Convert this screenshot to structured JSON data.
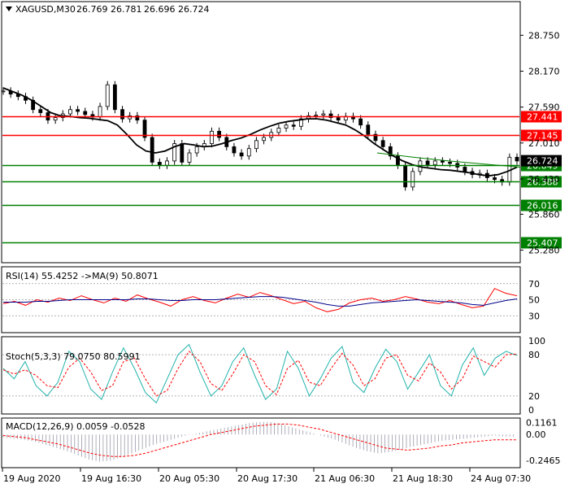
{
  "chart_data": {
    "type": "candlestick",
    "symbol_title": "XAGUSD,M30",
    "ohlc_header": [
      "26.769",
      "26.781",
      "26.696",
      "26.724"
    ],
    "current_price_label": "26.724",
    "y_ticks": [
      "28.750",
      "28.170",
      "27.590",
      "27.010",
      "26.430",
      "25.860",
      "25.280"
    ],
    "y_tick_values": [
      28.75,
      28.17,
      27.59,
      27.01,
      26.43,
      25.86,
      25.28
    ],
    "y_range": [
      25.09,
      29.28
    ],
    "x_ticks": [
      "19 Aug 2020",
      "19 Aug 16:30",
      "20 Aug 05:30",
      "20 Aug 17:30",
      "21 Aug 06:30",
      "21 Aug 18:30",
      "24 Aug 07:30"
    ],
    "levels": [
      {
        "value": 27.441,
        "label": "27.441",
        "color": "#ff0000"
      },
      {
        "value": 27.145,
        "label": "27.145",
        "color": "#ff0000"
      },
      {
        "value": 26.649,
        "label": "26.649",
        "color": "#008000"
      },
      {
        "value": 26.388,
        "label": "26.388",
        "color": "#008000"
      },
      {
        "value": 26.016,
        "label": "26.016",
        "color": "#008000"
      },
      {
        "value": 25.407,
        "label": "25.407",
        "color": "#008000"
      }
    ],
    "price_series": [
      27.85,
      27.8,
      27.76,
      27.7,
      27.55,
      27.5,
      27.38,
      27.42,
      27.48,
      27.55,
      27.52,
      27.47,
      27.43,
      27.6,
      27.95,
      27.55,
      27.4,
      27.45,
      27.38,
      27.1,
      26.7,
      26.65,
      26.72,
      27.0,
      26.7,
      26.85,
      26.95,
      27.0,
      27.2,
      27.1,
      26.95,
      26.85,
      26.8,
      26.92,
      27.05,
      27.1,
      27.18,
      27.25,
      27.3,
      27.28,
      27.4,
      27.45,
      27.46,
      27.48,
      27.42,
      27.38,
      27.44,
      27.4,
      27.3,
      27.15,
      27.05,
      26.95,
      26.8,
      26.65,
      26.3,
      26.55,
      26.72,
      26.66,
      26.72,
      26.7,
      26.68,
      26.62,
      26.55,
      26.5,
      26.52,
      26.45,
      26.42,
      26.38,
      26.78,
      26.72
    ],
    "ma_series": [
      27.9,
      27.84,
      27.78,
      27.7,
      27.6,
      27.5,
      27.45,
      27.44,
      27.42,
      27.41,
      27.39,
      27.37,
      27.3,
      27.15,
      26.98,
      26.88,
      26.85,
      26.88,
      26.95,
      27.0,
      26.98,
      26.95,
      26.96,
      27.0,
      27.05,
      27.09,
      27.15,
      27.22,
      27.28,
      27.33,
      27.36,
      27.38,
      27.4,
      27.4,
      27.38,
      27.34,
      27.3,
      27.22,
      27.12,
      27.0,
      26.9,
      26.8,
      26.72,
      26.66,
      26.62,
      26.6,
      26.58,
      26.57,
      26.55,
      26.53,
      26.5,
      26.48,
      26.5,
      26.55,
      26.62
    ],
    "trend_series": [
      26.85,
      26.78,
      26.72,
      26.67,
      26.62
    ],
    "rsi": {
      "label": "RSI(14) 55.4252  ->MA(9) 50.8071",
      "ticks": [
        "70",
        "50",
        "30"
      ],
      "tick_values": [
        70,
        50,
        30
      ],
      "range": [
        10,
        90
      ],
      "values": [
        45,
        48,
        43,
        50,
        47,
        52,
        49,
        55,
        50,
        46,
        52,
        48,
        56,
        51,
        47,
        42,
        50,
        54,
        49,
        46,
        52,
        57,
        53,
        59,
        55,
        50,
        45,
        48,
        40,
        35,
        38,
        46,
        50,
        52,
        48,
        50,
        54,
        51,
        47,
        45,
        49,
        44,
        40,
        42,
        64,
        58,
        55
      ],
      "ma_values": [
        47,
        47,
        47,
        48,
        48,
        49,
        50,
        50,
        50,
        50,
        50,
        50,
        51,
        51,
        50,
        49,
        49,
        50,
        50,
        50,
        51,
        52,
        53,
        54,
        54,
        53,
        51,
        49,
        47,
        44,
        42,
        42,
        44,
        46,
        47,
        48,
        49,
        50,
        49,
        48,
        47,
        46,
        44,
        43,
        46,
        49,
        51
      ]
    },
    "stoch": {
      "label": "Stoch(5,3,3) 79.0750 80.5991",
      "ticks": [
        "100",
        "80",
        "20",
        "0"
      ],
      "tick_values": [
        100,
        80,
        20,
        0
      ],
      "range": [
        -5,
        105
      ],
      "main": [
        60,
        45,
        70,
        35,
        20,
        40,
        85,
        70,
        30,
        15,
        55,
        90,
        60,
        25,
        10,
        45,
        80,
        95,
        55,
        20,
        35,
        70,
        90,
        50,
        15,
        30,
        85,
        60,
        20,
        45,
        75,
        92,
        40,
        25,
        60,
        88,
        70,
        30,
        55,
        80,
        35,
        20,
        65,
        90,
        50,
        75,
        85,
        79
      ],
      "signal": [
        58,
        52,
        58,
        50,
        35,
        32,
        62,
        75,
        55,
        28,
        35,
        70,
        75,
        45,
        20,
        28,
        60,
        85,
        70,
        38,
        28,
        52,
        80,
        70,
        35,
        22,
        60,
        72,
        40,
        35,
        60,
        82,
        65,
        35,
        45,
        75,
        80,
        50,
        42,
        68,
        55,
        30,
        45,
        78,
        70,
        62,
        80,
        81
      ]
    },
    "macd": {
      "label": "MACD(12,26,9) 0.0059 -0.0528",
      "ticks": [
        "0.1161",
        "0.00",
        "-0.2465"
      ],
      "tick_values": [
        0.1161,
        0.0,
        -0.2465
      ],
      "range": [
        -0.31,
        0.15
      ],
      "histogram": [
        -0.03,
        -0.04,
        -0.05,
        -0.07,
        -0.1,
        -0.13,
        -0.16,
        -0.2,
        -0.24,
        -0.26,
        -0.25,
        -0.22,
        -0.18,
        -0.14,
        -0.1,
        -0.07,
        -0.04,
        -0.01,
        0.01,
        0.03,
        0.05,
        0.07,
        0.09,
        0.11,
        0.12,
        0.12,
        0.1,
        0.07,
        0.04,
        0.01,
        -0.02,
        -0.05,
        -0.09,
        -0.13,
        -0.16,
        -0.18,
        -0.17,
        -0.15,
        -0.12,
        -0.1,
        -0.08,
        -0.06,
        -0.05,
        -0.04,
        -0.03,
        -0.02,
        -0.01,
        -0.02
      ],
      "signal": [
        -0.01,
        -0.02,
        -0.03,
        -0.05,
        -0.07,
        -0.09,
        -0.12,
        -0.15,
        -0.18,
        -0.2,
        -0.21,
        -0.21,
        -0.2,
        -0.18,
        -0.15,
        -0.12,
        -0.09,
        -0.06,
        -0.03,
        0.0,
        0.02,
        0.04,
        0.06,
        0.08,
        0.09,
        0.1,
        0.1,
        0.09,
        0.07,
        0.05,
        0.02,
        -0.01,
        -0.04,
        -0.07,
        -0.1,
        -0.13,
        -0.14,
        -0.15,
        -0.14,
        -0.13,
        -0.11,
        -0.1,
        -0.08,
        -0.07,
        -0.06,
        -0.05,
        -0.05,
        -0.05
      ]
    }
  }
}
